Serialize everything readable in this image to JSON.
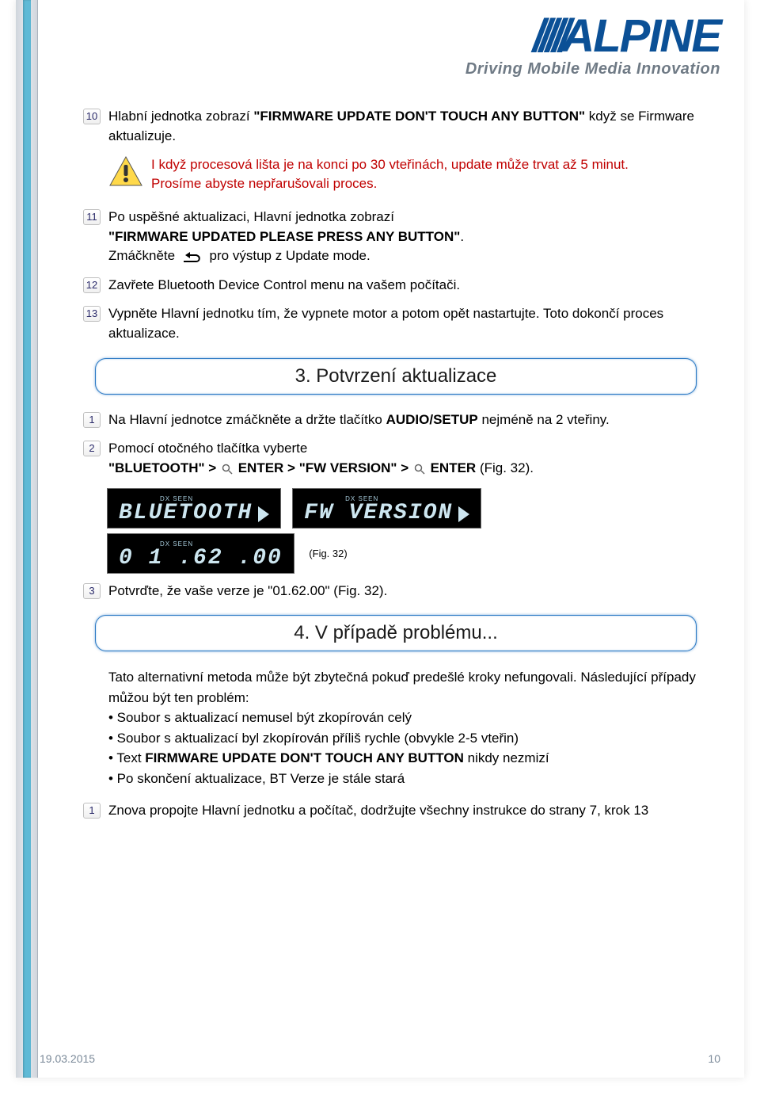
{
  "logo": {
    "brand": "ALPINE",
    "tagline": "Driving Mobile Media Innovation"
  },
  "steps_a": [
    {
      "num": "10",
      "pre": "Hlabní jednotka zobrazí ",
      "bold": "\"FIRMWARE UPDATE DON'T TOUCH ANY BUTTON\"",
      "post": " když se Firmware aktualizuje."
    }
  ],
  "warning": {
    "line1": "I když procesová lišta je na konci po 30 vteřinách, update může trvat až 5 minut.",
    "line2": "Prosíme abyste nepřarušovali proces."
  },
  "step11": {
    "num": "11",
    "pre": "Po uspěšné aktualizaci, Hlavní jednotka zobrazí",
    "bold": "\"FIRMWARE UPDATED PLEASE PRESS ANY BUTTON\"",
    "post_pre": "Zmáčkněte ",
    "post_post": " pro výstup z Update mode."
  },
  "step12": {
    "num": "12",
    "text": "Zavřete Bluetooth Device Control menu na vašem počítači."
  },
  "step13_top": {
    "num": "13",
    "text": "Vypněte Hlavní jednotku tím, že vypnete motor a potom opět nastartujte. Toto dokončí proces aktualizace."
  },
  "section3": {
    "title": "3. Potvrzení aktualizace"
  },
  "sec3_step1": {
    "num": "1",
    "pre": "Na Hlavní jednotce zmáčkněte a držte tlačítko ",
    "bold": "AUDIO/SETUP",
    "post": " nejméně na 2 vteřiny."
  },
  "sec3_step2": {
    "num": "2",
    "pre": "Pomocí otočného tlačítka vyberte",
    "b1": "\"BLUETOOTH\" > ",
    "b2": " ENTER > \"FW VERSION\" > ",
    "b3": " ENTER",
    "post": " (Fig. 32)."
  },
  "displays": {
    "d1_top": "DX    SEEN",
    "d1": "BLUETOOTH",
    "d2_top": "DX    SEEN",
    "d2": "FW VERSION",
    "d3_top": "DX    SEEN",
    "d3": "0 1 .62 .00",
    "fig": "(Fig. 32)"
  },
  "sec3_step3": {
    "num": "3",
    "text": "Potvrďte, že vaše verze je \"01.62.00\" (Fig. 32)."
  },
  "section4": {
    "title": "4. V případě problému..."
  },
  "problem": {
    "intro": "Tato alternativní metoda může být zbytečná pokuď predešlé kroky nefungovali. Následující případy můžou být ten problém:",
    "b1": "• Soubor s aktualizací nemusel být zkopírován celý",
    "b2": "• Soubor s aktualizací byl zkopírován příliš rychle (obvykle 2-5 vteřin)",
    "b3_pre": "• Text ",
    "b3_bold": "FIRMWARE UPDATE DON'T TOUCH ANY BUTTON",
    "b3_post": " nikdy nezmizí",
    "b4": "• Po skončení aktualizace, BT Verze je stále stará"
  },
  "sec4_step1": {
    "num": "1",
    "text": "Znova propojte Hlavní jednotku a počítač, dodržujte všechny instrukce do strany 7, krok 13"
  },
  "footer": {
    "date": "19.03.2015",
    "page": "10"
  }
}
